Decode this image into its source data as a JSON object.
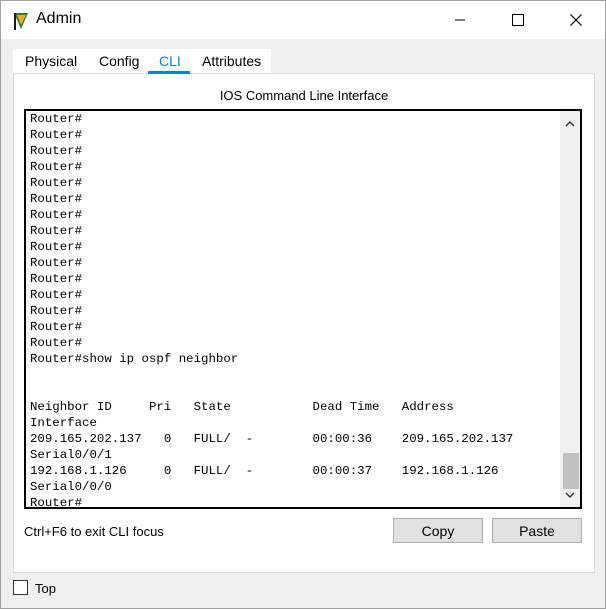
{
  "window": {
    "title": "Admin"
  },
  "tabs": [
    {
      "label": "Physical",
      "active": false
    },
    {
      "label": "Config",
      "active": false
    },
    {
      "label": "CLI",
      "active": true
    },
    {
      "label": "Attributes",
      "active": false
    }
  ],
  "cli": {
    "header": "IOS Command Line Interface",
    "lines": [
      "Router#",
      "Router#",
      "Router#",
      "Router#",
      "Router#",
      "Router#",
      "Router#",
      "Router#",
      "Router#",
      "Router#",
      "Router#",
      "Router#",
      "Router#",
      "Router#",
      "Router#",
      "Router#show ip ospf neighbor",
      "",
      "",
      "Neighbor ID     Pri   State           Dead Time   Address",
      "Interface",
      "209.165.202.137   0   FULL/  -        00:00:36    209.165.202.137",
      "Serial0/0/1",
      "192.168.1.126     0   FULL/  -        00:00:37    192.168.1.126",
      "Serial0/0/0",
      "Router#"
    ],
    "focus_hint": "Ctrl+F6 to exit CLI focus"
  },
  "buttons": {
    "copy": "Copy",
    "paste": "Paste"
  },
  "footer": {
    "top_label": "Top",
    "top_checked": false
  },
  "colors": {
    "accent": "#0f84c8"
  }
}
